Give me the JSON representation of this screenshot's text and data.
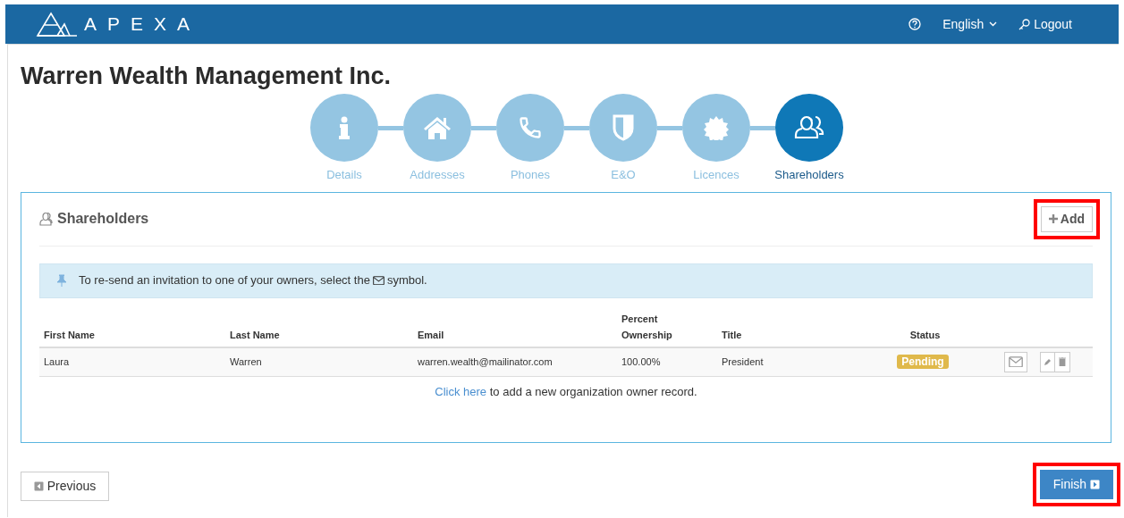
{
  "header": {
    "logo": "APEXA",
    "language": "English",
    "logout": "Logout"
  },
  "page_title": "Warren Wealth Management Inc.",
  "steps": [
    {
      "label": "Details",
      "selected": false
    },
    {
      "label": "Addresses",
      "selected": false
    },
    {
      "label": "Phones",
      "selected": false
    },
    {
      "label": "E&O",
      "selected": false
    },
    {
      "label": "Licences",
      "selected": false
    },
    {
      "label": "Shareholders",
      "selected": true
    }
  ],
  "panel": {
    "title": "Shareholders",
    "add_button": {
      "label": "Add",
      "highlighted": true
    },
    "alert": {
      "before": "To re-send an invitation to one of your owners, select the",
      "after": "symbol."
    },
    "table": {
      "columns": [
        {
          "lines": [
            "First Name"
          ]
        },
        {
          "lines": [
            "Last Name"
          ]
        },
        {
          "lines": [
            "Email"
          ]
        },
        {
          "lines": [
            "Percent",
            "Ownership"
          ]
        },
        {
          "lines": [
            "Title"
          ]
        },
        {
          "lines": [
            "Status"
          ]
        }
      ],
      "rows": [
        {
          "first_name": "Laura",
          "last_name": "Warren",
          "email": "warren.wealth@mailinator.com",
          "percent": "100.00%",
          "title": "President",
          "status": "Pending"
        }
      ]
    },
    "add_link": {
      "link": "Click here",
      "rest": "to add a new organization owner record."
    }
  },
  "footer": {
    "previous": {
      "label": "Previous"
    },
    "finish": {
      "label": "Finish",
      "highlighted": true
    }
  }
}
